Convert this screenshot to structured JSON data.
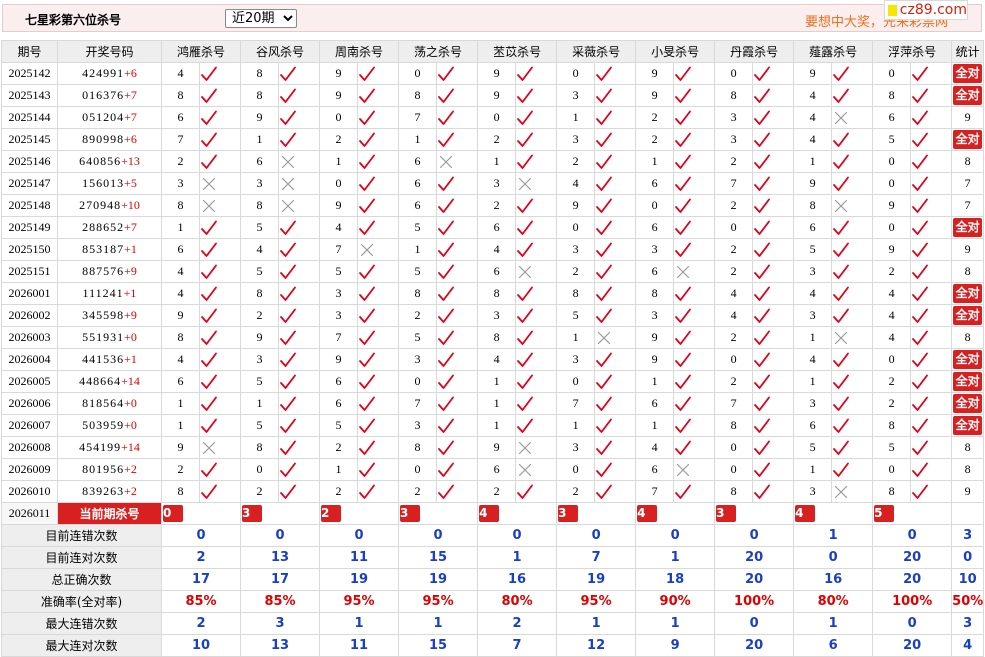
{
  "header": {
    "title": "七星彩第六位杀号",
    "period_select": "近20期",
    "promo": "要想中大奖，先来彩票网",
    "logo_text": "cz89.com"
  },
  "columns": {
    "period": "期号",
    "draw": "开奖号码",
    "experts": [
      "鸿雁杀号",
      "谷风杀号",
      "周南杀号",
      "荡之杀号",
      "苤苡杀号",
      "采薇杀号",
      "小旻杀号",
      "丹霞杀号",
      "薤露杀号",
      "浮萍杀号"
    ],
    "stat": "统计"
  },
  "rows": [
    {
      "period": "2025142",
      "digits": "424991",
      "add": "+6",
      "kills": [
        4,
        8,
        9,
        0,
        9,
        0,
        9,
        0,
        9,
        0
      ],
      "ok": [
        1,
        1,
        1,
        1,
        1,
        1,
        1,
        1,
        1,
        1
      ],
      "stat": "全对"
    },
    {
      "period": "2025143",
      "digits": "016376",
      "add": "+7",
      "kills": [
        8,
        8,
        9,
        8,
        9,
        3,
        9,
        8,
        4,
        8
      ],
      "ok": [
        1,
        1,
        1,
        1,
        1,
        1,
        1,
        1,
        1,
        1
      ],
      "stat": "全对"
    },
    {
      "period": "2025144",
      "digits": "051204",
      "add": "+7",
      "kills": [
        6,
        9,
        0,
        7,
        0,
        1,
        2,
        3,
        4,
        6
      ],
      "ok": [
        1,
        1,
        1,
        1,
        1,
        1,
        1,
        1,
        0,
        1
      ],
      "stat": "9"
    },
    {
      "period": "2025145",
      "digits": "890998",
      "add": "+6",
      "kills": [
        7,
        1,
        2,
        1,
        2,
        3,
        2,
        3,
        4,
        5
      ],
      "ok": [
        1,
        1,
        1,
        1,
        1,
        1,
        1,
        1,
        1,
        1
      ],
      "stat": "全对"
    },
    {
      "period": "2025146",
      "digits": "640856",
      "add": "+13",
      "kills": [
        2,
        6,
        1,
        6,
        1,
        2,
        1,
        2,
        1,
        0
      ],
      "ok": [
        1,
        0,
        1,
        0,
        1,
        1,
        1,
        1,
        1,
        1
      ],
      "stat": "8"
    },
    {
      "period": "2025147",
      "digits": "156013",
      "add": "+5",
      "kills": [
        3,
        3,
        0,
        6,
        3,
        4,
        6,
        7,
        9,
        0
      ],
      "ok": [
        0,
        0,
        1,
        1,
        0,
        1,
        1,
        1,
        1,
        1
      ],
      "stat": "7"
    },
    {
      "period": "2025148",
      "digits": "270948",
      "add": "+10",
      "kills": [
        8,
        8,
        9,
        6,
        2,
        9,
        0,
        2,
        8,
        9
      ],
      "ok": [
        0,
        0,
        1,
        1,
        1,
        1,
        1,
        1,
        0,
        1
      ],
      "stat": "7"
    },
    {
      "period": "2025149",
      "digits": "288652",
      "add": "+7",
      "kills": [
        1,
        5,
        4,
        5,
        6,
        0,
        6,
        0,
        6,
        0
      ],
      "ok": [
        1,
        1,
        1,
        1,
        1,
        1,
        1,
        1,
        1,
        1
      ],
      "stat": "全对"
    },
    {
      "period": "2025150",
      "digits": "853187",
      "add": "+1",
      "kills": [
        6,
        4,
        7,
        1,
        4,
        3,
        3,
        2,
        5,
        9
      ],
      "ok": [
        1,
        1,
        0,
        1,
        1,
        1,
        1,
        1,
        1,
        1
      ],
      "stat": "9"
    },
    {
      "period": "2025151",
      "digits": "887576",
      "add": "+9",
      "kills": [
        4,
        5,
        5,
        5,
        6,
        2,
        6,
        2,
        3,
        2
      ],
      "ok": [
        1,
        1,
        1,
        1,
        0,
        1,
        0,
        1,
        1,
        1
      ],
      "stat": "8"
    },
    {
      "period": "2026001",
      "digits": "111241",
      "add": "+1",
      "kills": [
        4,
        8,
        3,
        8,
        8,
        8,
        8,
        4,
        4,
        4
      ],
      "ok": [
        1,
        1,
        1,
        1,
        1,
        1,
        1,
        1,
        1,
        1
      ],
      "stat": "全对"
    },
    {
      "period": "2026002",
      "digits": "345598",
      "add": "+9",
      "kills": [
        9,
        2,
        3,
        2,
        3,
        5,
        3,
        4,
        3,
        4
      ],
      "ok": [
        1,
        1,
        1,
        1,
        1,
        1,
        1,
        1,
        1,
        1
      ],
      "stat": "全对"
    },
    {
      "period": "2026003",
      "digits": "551931",
      "add": "+0",
      "kills": [
        8,
        9,
        7,
        5,
        8,
        1,
        9,
        2,
        1,
        4
      ],
      "ok": [
        1,
        1,
        1,
        1,
        1,
        0,
        1,
        1,
        0,
        1
      ],
      "stat": "8"
    },
    {
      "period": "2026004",
      "digits": "441536",
      "add": "+1",
      "kills": [
        4,
        3,
        9,
        3,
        4,
        3,
        9,
        0,
        4,
        0
      ],
      "ok": [
        1,
        1,
        1,
        1,
        1,
        1,
        1,
        1,
        1,
        1
      ],
      "stat": "全对"
    },
    {
      "period": "2026005",
      "digits": "448664",
      "add": "+14",
      "kills": [
        6,
        5,
        6,
        0,
        1,
        0,
        1,
        2,
        1,
        2
      ],
      "ok": [
        1,
        1,
        1,
        1,
        1,
        1,
        1,
        1,
        1,
        1
      ],
      "stat": "全对"
    },
    {
      "period": "2026006",
      "digits": "818564",
      "add": "+0",
      "kills": [
        1,
        1,
        6,
        7,
        1,
        7,
        6,
        7,
        3,
        2
      ],
      "ok": [
        1,
        1,
        1,
        1,
        1,
        1,
        1,
        1,
        1,
        1
      ],
      "stat": "全对"
    },
    {
      "period": "2026007",
      "digits": "503959",
      "add": "+0",
      "kills": [
        1,
        5,
        5,
        3,
        1,
        1,
        1,
        8,
        6,
        8
      ],
      "ok": [
        1,
        1,
        1,
        1,
        1,
        1,
        1,
        1,
        1,
        1
      ],
      "stat": "全对"
    },
    {
      "period": "2026008",
      "digits": "454199",
      "add": "+14",
      "kills": [
        9,
        8,
        2,
        8,
        9,
        3,
        4,
        0,
        5,
        5
      ],
      "ok": [
        0,
        1,
        1,
        1,
        0,
        1,
        1,
        1,
        1,
        1
      ],
      "stat": "8"
    },
    {
      "period": "2026009",
      "digits": "801956",
      "add": "+2",
      "kills": [
        2,
        0,
        1,
        0,
        6,
        0,
        6,
        0,
        1,
        0
      ],
      "ok": [
        1,
        1,
        1,
        1,
        0,
        1,
        0,
        1,
        1,
        1
      ],
      "stat": "8"
    },
    {
      "period": "2026010",
      "digits": "839263",
      "add": "+2",
      "kills": [
        8,
        2,
        2,
        2,
        2,
        2,
        7,
        8,
        3,
        8
      ],
      "ok": [
        1,
        1,
        1,
        1,
        1,
        1,
        1,
        1,
        0,
        1
      ],
      "stat": "9"
    }
  ],
  "current": {
    "period": "2026011",
    "label": "当前期杀号",
    "kills": [
      "0",
      "3",
      "2",
      "3",
      "4",
      "3",
      "4",
      "3",
      "4",
      "5"
    ]
  },
  "summary": [
    {
      "label": "目前连错次数",
      "values": [
        "0",
        "0",
        "0",
        "0",
        "0",
        "0",
        "0",
        "0",
        "1",
        "0",
        "3"
      ]
    },
    {
      "label": "目前连对次数",
      "values": [
        "2",
        "13",
        "11",
        "15",
        "1",
        "7",
        "1",
        "20",
        "0",
        "20",
        "0"
      ]
    },
    {
      "label": "总正确次数",
      "values": [
        "17",
        "17",
        "19",
        "19",
        "16",
        "19",
        "18",
        "20",
        "16",
        "20",
        "10"
      ]
    },
    {
      "label": "准确率(全对率)",
      "values": [
        "85%",
        "85%",
        "95%",
        "95%",
        "80%",
        "95%",
        "90%",
        "100%",
        "80%",
        "100%",
        "50%"
      ],
      "red": true
    },
    {
      "label": "最大连错次数",
      "values": [
        "2",
        "3",
        "1",
        "1",
        "2",
        "1",
        "1",
        "0",
        "1",
        "0",
        "3"
      ]
    },
    {
      "label": "最大连对次数",
      "values": [
        "10",
        "13",
        "11",
        "15",
        "7",
        "12",
        "9",
        "20",
        "6",
        "20",
        "4"
      ]
    }
  ],
  "colors": {
    "check": "#e0001a",
    "cross": "#9a9a9a",
    "badge": "#d82020",
    "stat_blue": "#1a3fc7",
    "stat_red": "#e00000",
    "header_bg": "#eeeeee",
    "topbar_bg": "#fbeeee"
  },
  "icons": {
    "correct": "check-icon",
    "wrong": "cross-icon"
  }
}
